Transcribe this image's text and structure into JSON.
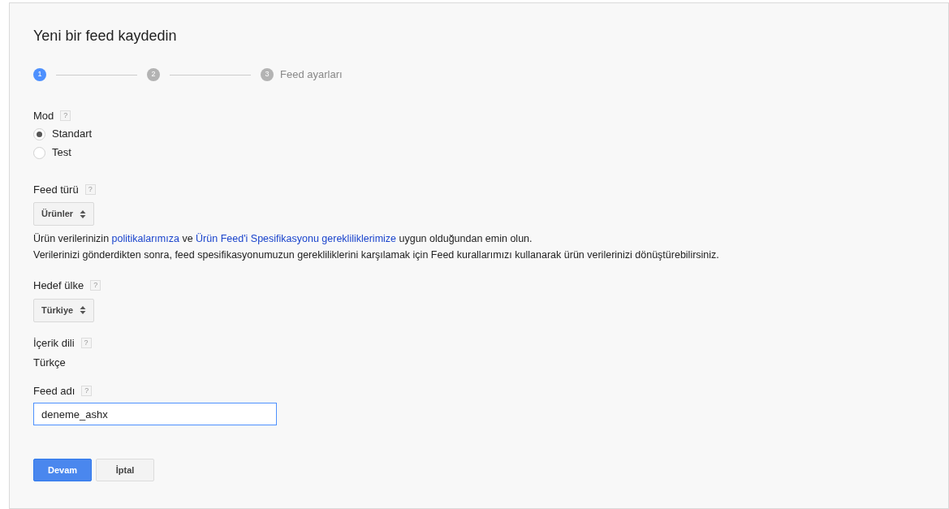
{
  "title": "Yeni bir feed kaydedin",
  "steps": [
    {
      "number": "1",
      "selected": true
    },
    {
      "number": "2",
      "selected": false
    },
    {
      "number": "3",
      "label": "Feed ayarları",
      "selected": false
    }
  ],
  "mode": {
    "label": "Mod",
    "help": "?",
    "options": [
      {
        "label": "Standart",
        "selected": true
      },
      {
        "label": "Test",
        "selected": false
      }
    ]
  },
  "feed_type": {
    "label": "Feed türü",
    "help": "?",
    "value": "Ürünler"
  },
  "info": [
    [
      {
        "kind": "text",
        "text": "Ürün verilerinizin "
      },
      {
        "kind": "link",
        "text": "politikalarımıza"
      },
      {
        "kind": "text",
        "text": " ve "
      },
      {
        "kind": "link",
        "text": "Ürün Feed'i Spesifikasyonu gerekliliklerimize"
      },
      {
        "kind": "text",
        "text": " uygun olduğundan emin olun."
      }
    ],
    [
      {
        "kind": "text",
        "text": "Verilerinizi gönderdikten sonra, feed spesifikasyonumuzun gerekliliklerini karşılamak için Feed kurallarımızı kullanarak ürün verilerinizi dönüştürebilirsiniz."
      }
    ]
  ],
  "target_country": {
    "label": "Hedef ülke",
    "help": "?",
    "value": "Türkiye"
  },
  "content_language": {
    "label": "İçerik dili",
    "help": "?",
    "value": "Türkçe"
  },
  "feed_name": {
    "label": "Feed adı",
    "help": "?",
    "value": "deneme_ashx"
  },
  "buttons": [
    {
      "kind": "primary",
      "label": "Devam"
    },
    {
      "kind": "secondary",
      "label": "İptal"
    }
  ]
}
